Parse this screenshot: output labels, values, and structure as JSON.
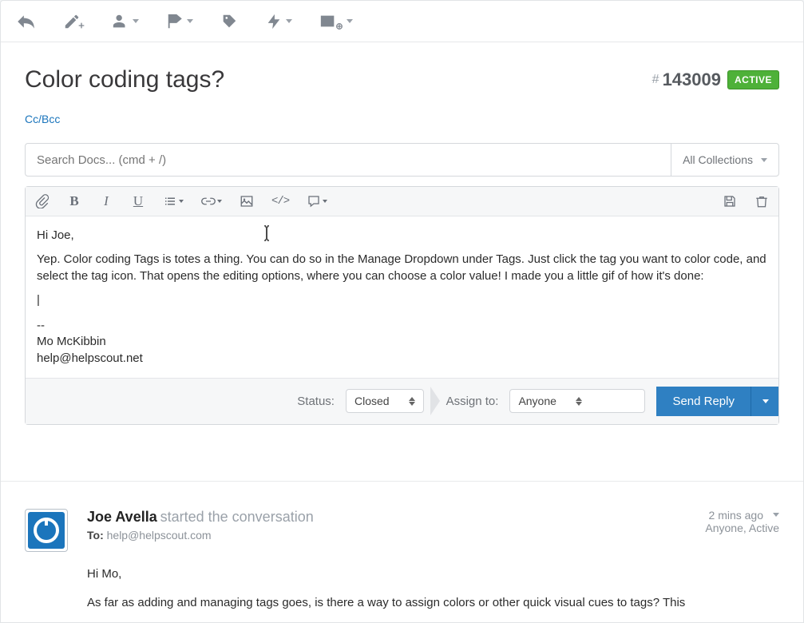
{
  "ticket": {
    "title": "Color coding tags?",
    "id": "143009",
    "status_badge": "ACTIVE"
  },
  "ccbcc_label": "Cc/Bcc",
  "search": {
    "placeholder": "Search Docs... (cmd + /)",
    "collections_label": "All Collections"
  },
  "reply": {
    "greeting": "Hi Joe,",
    "body": "Yep. Color coding Tags is totes a thing. You can do so in the Manage Dropdown under Tags. Just click the tag you want to color code, and select the tag icon. That opens the editing options, where you can choose a color value! I made you a little gif of how it's done:",
    "sig_divider": "--",
    "sig_name": "Mo McKibbin",
    "sig_email": "help@helpscout.net"
  },
  "footer": {
    "status_label": "Status:",
    "status_value": "Closed",
    "assign_label": "Assign to:",
    "assign_value": "Anyone",
    "send_label": "Send Reply"
  },
  "history": {
    "from_name": "Joe Avella",
    "action_text": "started the conversation",
    "to_label": "To:",
    "to_address": "help@helpscout.com",
    "timestamp": "2 mins ago",
    "meta": "Anyone, Active",
    "greeting": "Hi Mo,",
    "body": "As far as adding and managing tags goes, is there a way to assign colors or other quick visual cues to tags? This"
  }
}
